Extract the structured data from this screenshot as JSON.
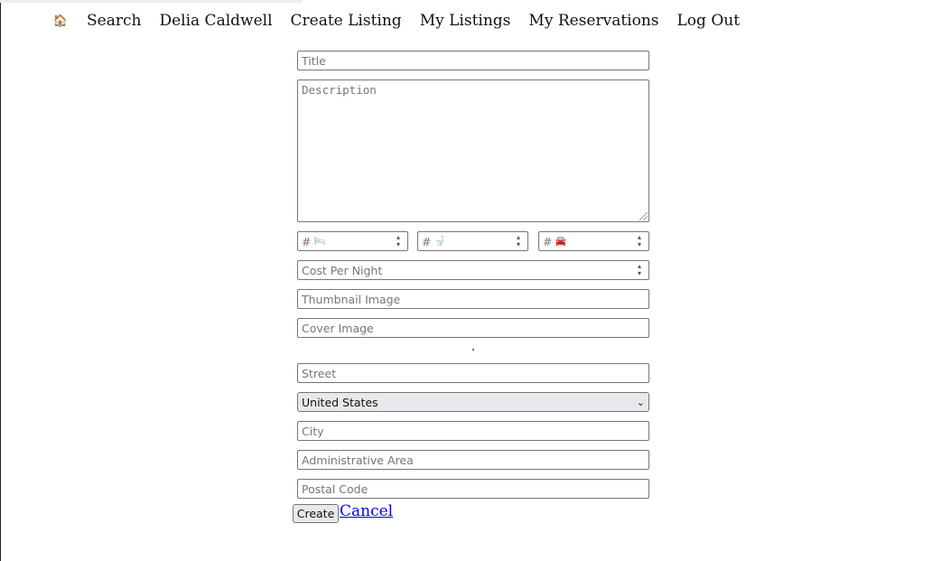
{
  "nav": {
    "home_icon": "🏠",
    "search": "Search",
    "user": "Delia Caldwell",
    "create_listing": "Create Listing",
    "my_listings": "My Listings",
    "my_reservations": "My Reservations",
    "log_out": "Log Out"
  },
  "form": {
    "title_placeholder": "Title",
    "description_placeholder": "Description",
    "beds_prefix": "#",
    "beds_icon": "🛏",
    "baths_prefix": "#",
    "baths_icon": "🚽",
    "parking_prefix": "#",
    "parking_icon": "🚘",
    "cost_placeholder": "Cost Per Night",
    "thumbnail_placeholder": "Thumbnail Image",
    "cover_placeholder": "Cover Image",
    "street_placeholder": "Street",
    "country_selected": "United States",
    "city_placeholder": "City",
    "admin_area_placeholder": "Administrative Area",
    "postal_placeholder": "Postal Code",
    "create_label": "Create",
    "cancel_label": "Cancel"
  },
  "colors": {
    "link": "#0000ee",
    "border": "#767676",
    "button_bg": "#e9e9ed"
  }
}
